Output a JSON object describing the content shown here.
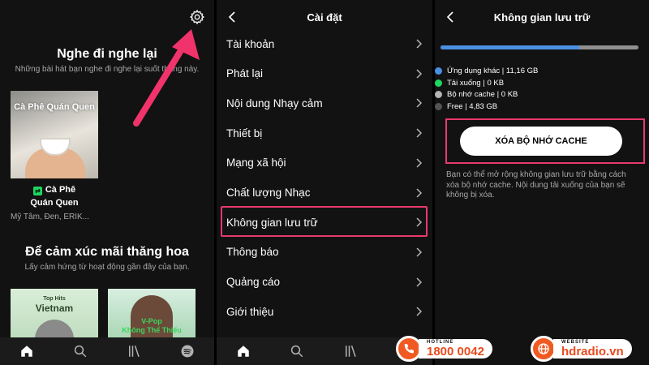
{
  "home": {
    "recent_title": "Nghe đi nghe lại",
    "recent_subtitle": "Những bài hát bạn nghe đi nghe lại suốt tháng này.",
    "playlist_cover_title": "Cà Phê Quán Quen",
    "playlist_name_line1": "Cà Phê",
    "playlist_name_line2": "Quán Quen",
    "playlist_artists": "Mỹ Tâm, Đen, ERIK...",
    "mood_title": "Để cảm xúc mãi thăng hoa",
    "mood_subtitle": "Lấy cảm hứng từ hoạt động gần đây của bạn.",
    "cover_top_hits_small": "Top Hits",
    "cover_top_hits_big": "Vietnam",
    "cover_vpop_line1": "V-Pop",
    "cover_vpop_line2": "Không Thể Thiếu"
  },
  "settings": {
    "title": "Cài đặt",
    "items": [
      {
        "label": "Tài khoản"
      },
      {
        "label": "Phát lại"
      },
      {
        "label": "Nội dung Nhạy cảm"
      },
      {
        "label": "Thiết bị"
      },
      {
        "label": "Mạng xã hội"
      },
      {
        "label": "Chất lượng Nhạc"
      },
      {
        "label": "Không gian lưu trữ"
      },
      {
        "label": "Thông báo"
      },
      {
        "label": "Quảng cáo"
      },
      {
        "label": "Giới thiệu"
      }
    ]
  },
  "storage": {
    "title": "Không gian lưu trữ",
    "used_fraction": 0.7,
    "legend": [
      {
        "label": "Ứng dụng khác | 11,16 GB",
        "color": "#4a90e2"
      },
      {
        "label": "Tải xuống | 0 KB",
        "color": "#1ed760"
      },
      {
        "label": "Bộ nhớ cache | 0 KB",
        "color": "#b3b3b3"
      },
      {
        "label": "Free | 4,83 GB",
        "color": "#535353"
      }
    ],
    "clear_cache_label": "XÓA BỘ NHỚ CACHE",
    "description": "Bạn có thể mở rộng không gian lưu trữ bằng cách xóa bộ nhớ cache. Nội dung tải xuống của bạn sẽ không bị xóa."
  },
  "promo": {
    "hotline_label": "HOTLINE",
    "hotline_value": "1800 0042",
    "website_label": "WEBSITE",
    "website_value": "hdradio.vn"
  },
  "colors": {
    "accent_highlight": "#e8396e",
    "spotify_green": "#1ed760",
    "brand_orange": "#f05a22"
  }
}
